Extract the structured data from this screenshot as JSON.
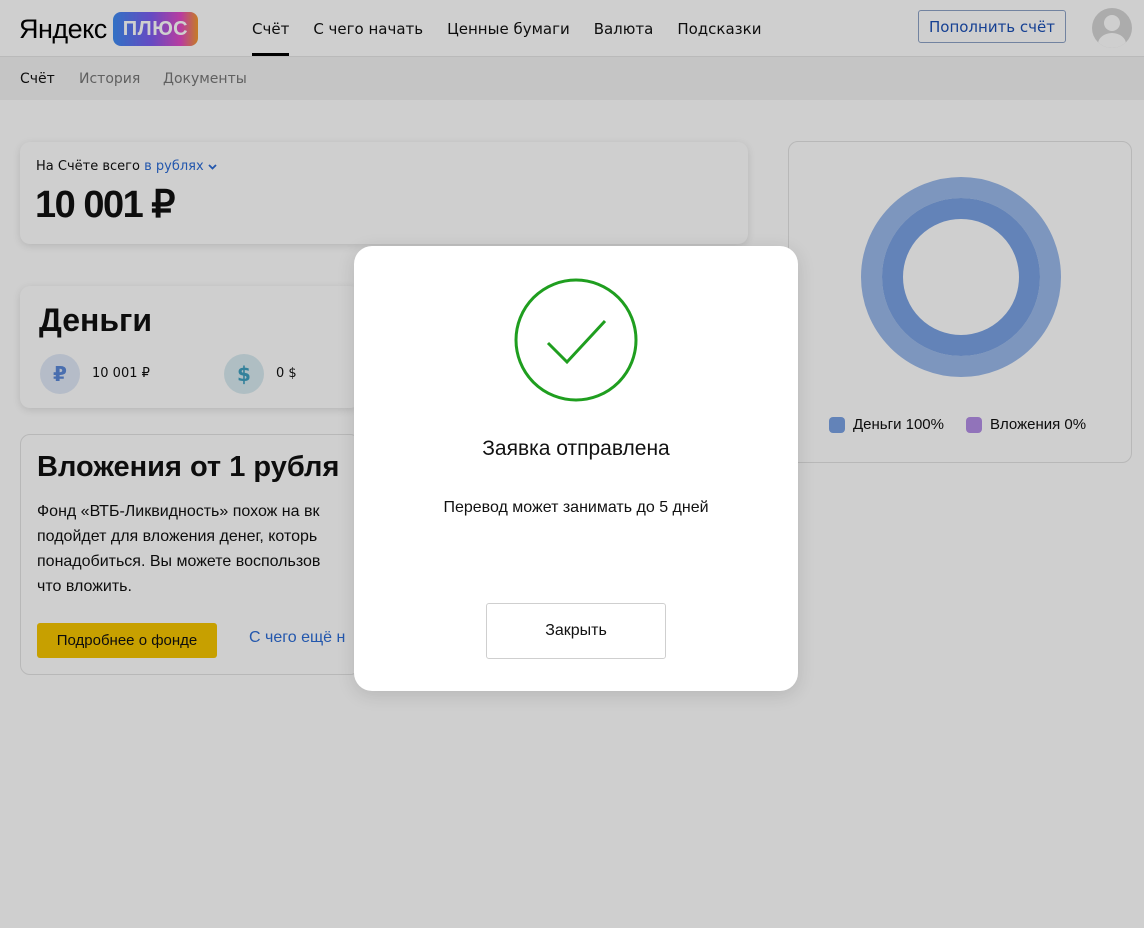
{
  "header": {
    "logo_text": "Яндекс",
    "logo_badge": "ПЛЮС",
    "nav": [
      "Счёт",
      "С чего начать",
      "Ценные бумаги",
      "Валюта",
      "Подсказки"
    ],
    "topup_label": "Пополнить счёт"
  },
  "subnav": [
    "Счёт",
    "История",
    "Документы"
  ],
  "total": {
    "label": "На Счёте всего",
    "currency_link": "в рублях",
    "value": "10 001 ₽"
  },
  "money": {
    "title": "Деньги",
    "rub_symbol": "₽",
    "rub_value": "10 001 ₽",
    "usd_symbol": "$",
    "usd_value": "0 $"
  },
  "invest": {
    "title": "Вложения от 1 рубля",
    "lines": [
      "Фонд «ВТБ-Ликвидность» похож на вк",
      "подойдет для вложения денег, которь",
      "понадобиться. Вы можете воспользов",
      "что вложить."
    ],
    "button": "Подробнее о фонде",
    "link": "С чего ещё н"
  },
  "chart_data": {
    "type": "pie",
    "categories": [
      "Деньги",
      "Вложения"
    ],
    "values": [
      100,
      0
    ],
    "legend": [
      {
        "label": "Деньги 100%",
        "color": "#7aa2e3"
      },
      {
        "label": "Вложения 0%",
        "color": "#b38ee6"
      }
    ]
  },
  "modal": {
    "title": "Заявка отправлена",
    "text": "Перевод может занимать до 5 дней",
    "close_label": "Закрыть",
    "check_color": "#1f9e1f"
  }
}
